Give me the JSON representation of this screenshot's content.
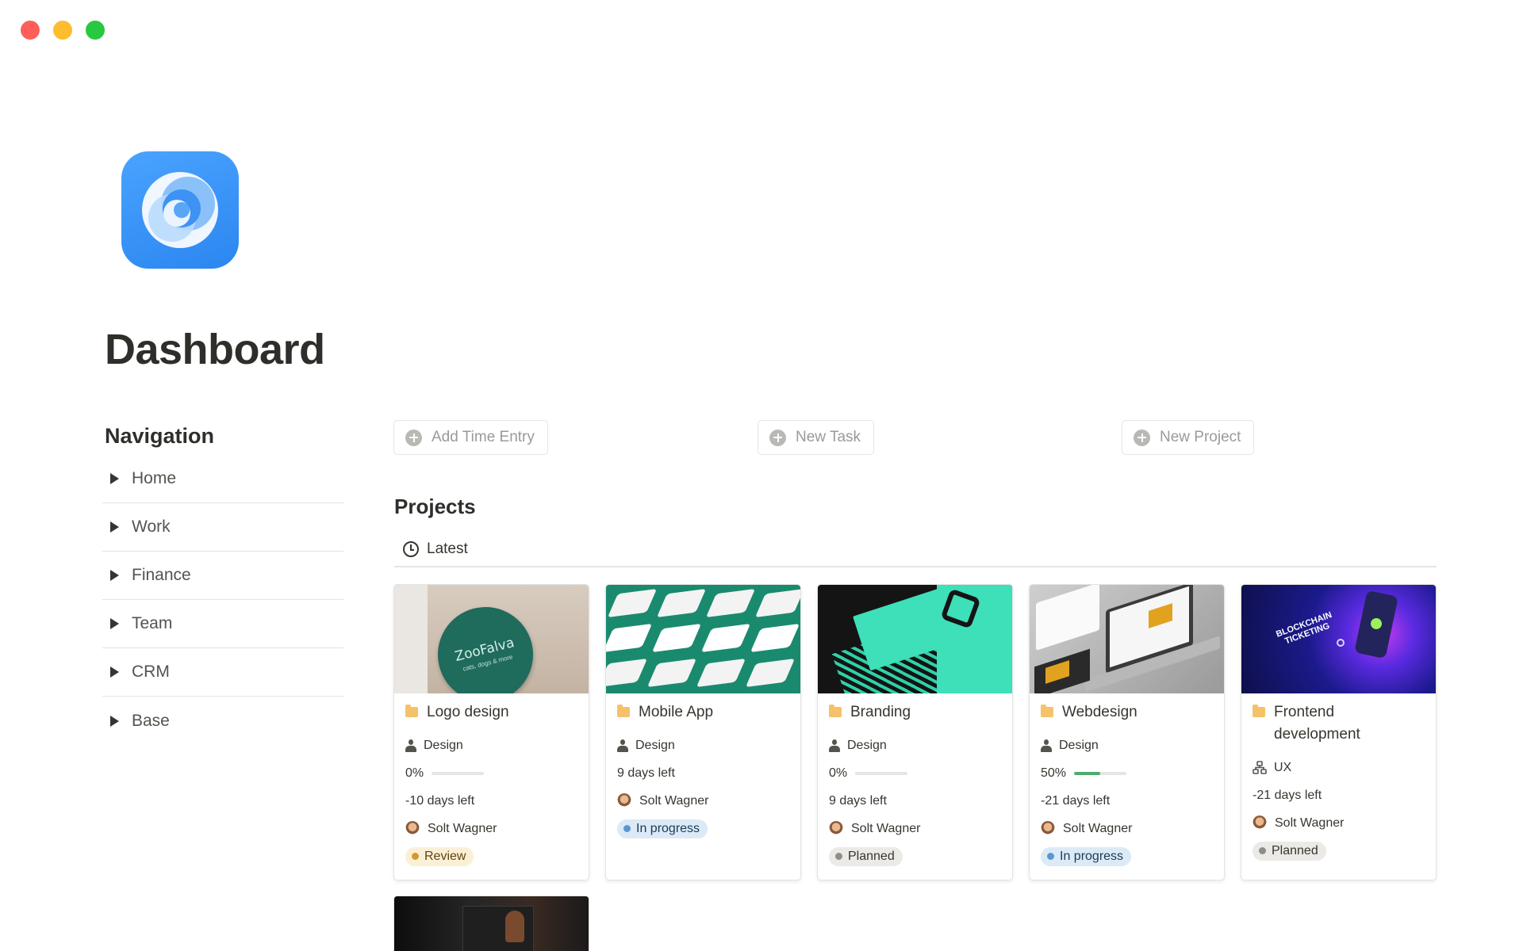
{
  "page": {
    "title": "Dashboard",
    "icon": "swirl-logo-icon"
  },
  "navigation": {
    "heading": "Navigation",
    "items": [
      {
        "label": "Home"
      },
      {
        "label": "Work"
      },
      {
        "label": "Finance"
      },
      {
        "label": "Team"
      },
      {
        "label": "CRM"
      },
      {
        "label": "Base"
      }
    ]
  },
  "actions": {
    "add_time_entry": "Add Time Entry",
    "new_task": "New Task",
    "new_project": "New Project"
  },
  "projects": {
    "title": "Projects",
    "view_tab": "Latest",
    "cards": [
      {
        "title": "Logo design",
        "category": "Design",
        "progress_label": "0%",
        "progress": 0,
        "days_left": "-10 days left",
        "owner": "Solt Wagner",
        "status": "Review"
      },
      {
        "title": "Mobile App",
        "category": "Design",
        "days_left": "9 days left",
        "owner": "Solt Wagner",
        "status": "In progress"
      },
      {
        "title": "Branding",
        "category": "Design",
        "progress_label": "0%",
        "progress": 0,
        "days_left": "9 days left",
        "owner": "Solt Wagner",
        "status": "Planned"
      },
      {
        "title": "Webdesign",
        "category": "Design",
        "progress_label": "50%",
        "progress": 0.5,
        "days_left": "-21 days left",
        "owner": "Solt Wagner",
        "status": "In progress"
      },
      {
        "title": "Frontend development",
        "category": "UX",
        "days_left": "-21 days left",
        "owner": "Solt Wagner",
        "status": "Planned"
      }
    ],
    "card_covers": [
      {
        "brand_text": "ZooFalva",
        "brand_sub": "cats, dogs & more"
      },
      {},
      {},
      {},
      {
        "banner_text": "BLOCKCHAIN TICKETING"
      }
    ]
  },
  "colors": {
    "window_red": "#ff5f57",
    "window_yellow": "#febc2e",
    "window_green": "#28c840",
    "icon_blue": "#2b86f0",
    "progress_green": "#4dab6d",
    "folder_orange": "#f5c26b"
  }
}
